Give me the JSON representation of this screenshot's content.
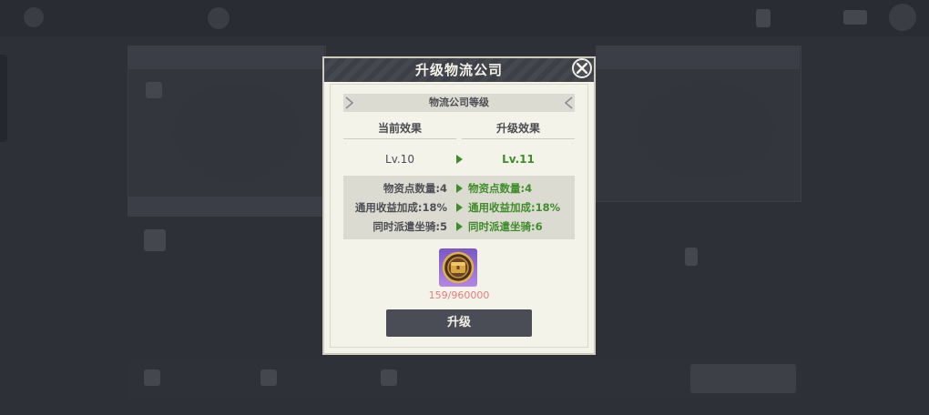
{
  "dialog": {
    "title": "升级物流公司",
    "section_title": "物流公司等级",
    "current_header": "当前效果",
    "next_header": "升级效果",
    "current_level": "Lv.10",
    "next_level": "Lv.11",
    "effects": [
      {
        "current": "物资点数量:4",
        "next": "物资点数量:4"
      },
      {
        "current": "通用收益加成:18%",
        "next": "通用收益加成:18%"
      },
      {
        "current": "同时派遣坐骑:5",
        "next": "同时派遣坐骑:6"
      }
    ],
    "cost": "159/960000",
    "upgrade_label": "升级"
  },
  "colors": {
    "header_bg": "#3d4047",
    "panel_bg": "#f4f3ea",
    "effect_green": "#3f8d2a",
    "cost_red": "#e77c7c",
    "button_bg": "#4a4d55",
    "item_purple": "#8f63d1"
  },
  "icons": {
    "close": "close-x-icon",
    "item": "treasure-chest-icon",
    "arrow": "play-arrow-icon"
  }
}
